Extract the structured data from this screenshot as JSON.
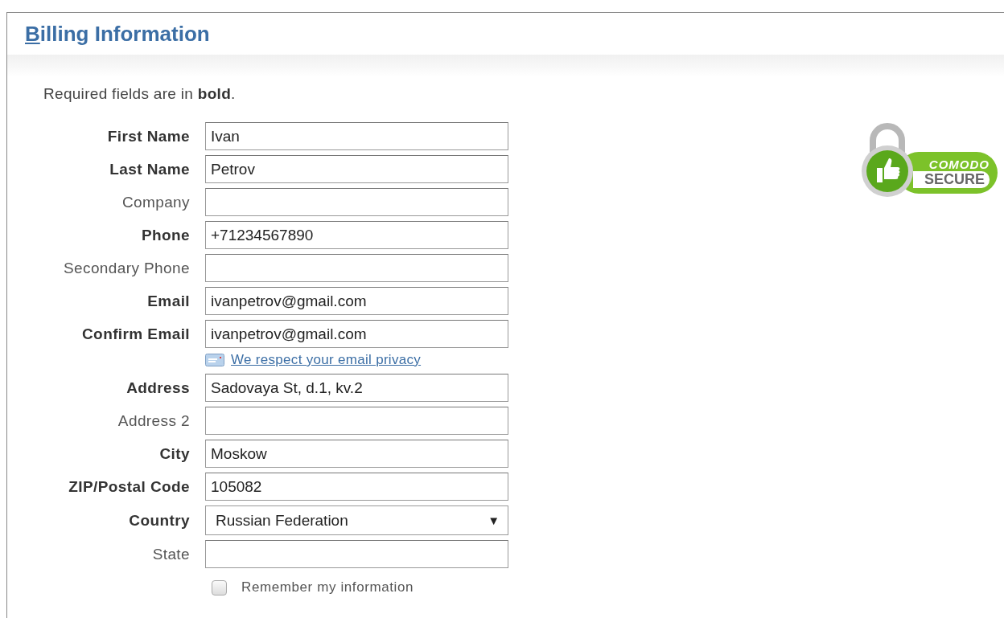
{
  "panel": {
    "title": "Billing Information"
  },
  "note": "Required fields are in **bold**.",
  "fields": [
    {
      "label": "First Name",
      "required": true,
      "kind": "text",
      "value": "Ivan"
    },
    {
      "label": "Last Name",
      "required": true,
      "kind": "text",
      "value": "Petrov"
    },
    {
      "label": "Company",
      "required": false,
      "kind": "text"
    },
    {
      "label": "Phone",
      "required": true,
      "kind": "text",
      "value": "+71234567890"
    },
    {
      "label": "Secondary Phone",
      "required": false,
      "kind": "text"
    },
    {
      "label": "Email",
      "required": true,
      "kind": "text",
      "value": "ivanpetrov@gmail.com"
    },
    {
      "label": "Confirm Email",
      "required": true,
      "kind": "text",
      "value": "ivanpetrov@gmail.com",
      "link": "We respect your email privacy"
    },
    {
      "label": "Address",
      "required": true,
      "kind": "text",
      "value": "Sadovaya St, d.1, kv.2"
    },
    {
      "label": "Address 2",
      "required": false,
      "kind": "text"
    },
    {
      "label": "City",
      "required": true,
      "kind": "text",
      "value": "Moskow"
    },
    {
      "label": "ZIP/Postal Code",
      "required": true,
      "kind": "text",
      "value": "105082"
    },
    {
      "label": "Country",
      "required": true,
      "kind": "select",
      "value": "Russian Federation",
      "arrow": "▼"
    },
    {
      "label": "State",
      "required": false,
      "kind": "text"
    }
  ],
  "remember": {
    "label": "Remember my information",
    "checked": false
  },
  "badge": {
    "line_1": "COMODO",
    "line_2": "SECURE"
  }
}
